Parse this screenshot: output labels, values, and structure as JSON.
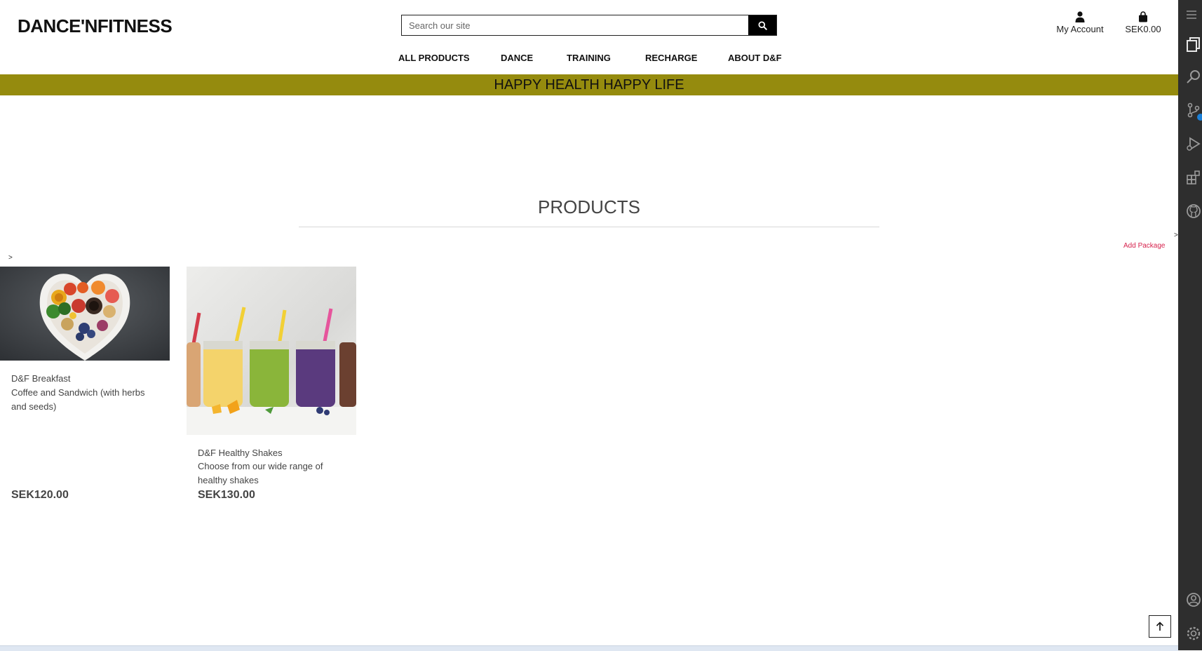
{
  "header": {
    "logo": "DANCE'NFITNESS",
    "search_placeholder": "Search our site",
    "account_label": "My Account",
    "cart_total": "SEK0.00"
  },
  "nav": {
    "items": [
      "ALL PRODUCTS",
      "DANCE",
      "TRAINING",
      "RECHARGE",
      "ABOUT D&F"
    ]
  },
  "banner": {
    "text": "HAPPY HEALTH HAPPY LIFE"
  },
  "page": {
    "title": "PRODUCTS",
    "chevron": ">",
    "add_package": "Add Package"
  },
  "products": [
    {
      "name": "D&F Breakfast",
      "description": "Coffee and Sandwich (with herbs and seeds)",
      "price": "SEK120.00"
    },
    {
      "name": "D&F Healthy Shakes",
      "description": "Choose from our wide range of healthy shakes",
      "price": "SEK130.00"
    }
  ],
  "colors": {
    "accent_line": "#a0185a",
    "banner": "#958b0e",
    "add_package": "#d6224d"
  },
  "icons": [
    "search-icon",
    "user-icon",
    "shopping-bag-icon",
    "arrow-up-icon",
    "files-icon",
    "search-icon",
    "source-control-icon",
    "run-debug-icon",
    "extensions-icon",
    "github-icon",
    "account-icon",
    "settings-gear-icon",
    "menu-icon"
  ]
}
